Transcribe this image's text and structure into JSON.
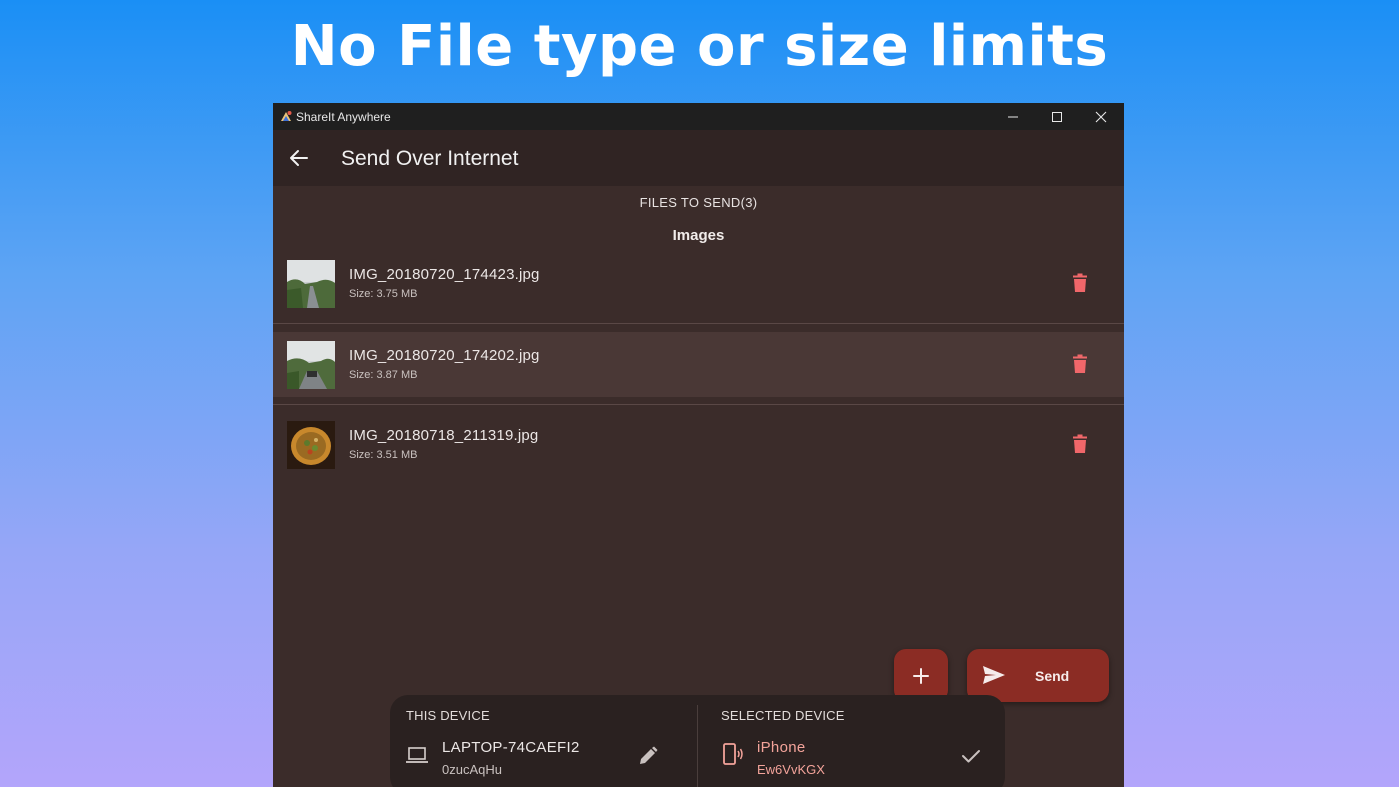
{
  "headline": "No File type or size limits",
  "window": {
    "title": "ShareIt Anywhere",
    "controls": [
      "minimize-icon",
      "maximize-icon",
      "close-icon"
    ]
  },
  "appbar": {
    "back_icon": "arrow-left-icon",
    "title": "Send Over Internet"
  },
  "files_header": "FILES TO SEND(3)",
  "section_title": "Images",
  "files": [
    {
      "name": "IMG_20180720_174423.jpg",
      "size": "Size: 3.75 MB",
      "thumb": "road-landscape"
    },
    {
      "name": "IMG_20180720_174202.jpg",
      "size": "Size: 3.87 MB",
      "thumb": "road-with-vehicle"
    },
    {
      "name": "IMG_20180718_211319.jpg",
      "size": "Size: 3.51 MB",
      "thumb": "food-plate"
    }
  ],
  "actions": {
    "add_icon": "plus-icon",
    "send_icon": "send-icon",
    "send_label": "Send"
  },
  "this_device": {
    "label": "THIS DEVICE",
    "name": "LAPTOP-74CAEFI2",
    "id": "0zucAqHu",
    "icon": "laptop-icon",
    "action_icon": "pencil-icon"
  },
  "selected_device": {
    "label": "SELECTED DEVICE",
    "name": "iPhone",
    "id": "Ew6VvKGX",
    "icon": "phone-signal-icon",
    "action_icon": "check-icon"
  },
  "colors": {
    "accent": "#8b2c24",
    "delete": "#f0676a",
    "selected_text": "#f3a39a",
    "window_bg": "#3b2c2a"
  }
}
